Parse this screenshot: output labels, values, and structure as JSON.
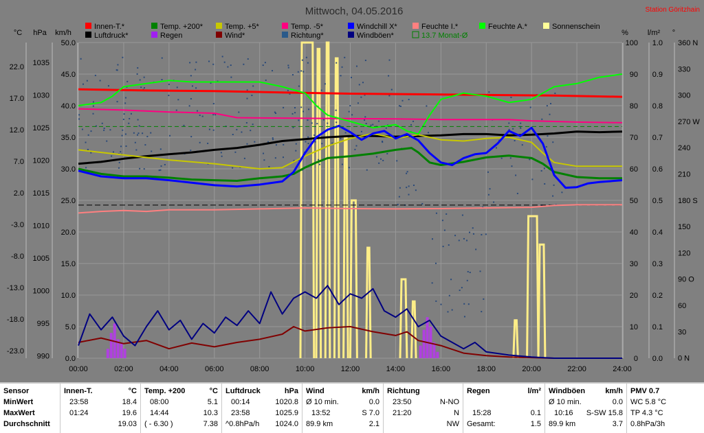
{
  "title": "Mittwoch, 04.05.2016",
  "station": "Station Göritzhain",
  "left_axis_units": [
    "°C",
    "hPa",
    "km/h"
  ],
  "right_axis_units": [
    "%",
    "l/m²",
    "°"
  ],
  "legend": [
    {
      "label": "Innen-T.*",
      "color": "#ff0000"
    },
    {
      "label": "Luftdruck*",
      "color": "#000000"
    },
    {
      "label": "Temp. +200*",
      "color": "#008000"
    },
    {
      "label": "Regen",
      "color": "#a020f0"
    },
    {
      "label": "Temp. +5*",
      "color": "#c8c800"
    },
    {
      "label": "Wind*",
      "color": "#800000"
    },
    {
      "label": "Temp. -5*",
      "color": "#ff0080"
    },
    {
      "label": "Richtung*",
      "color": "#2a5a8a"
    },
    {
      "label": "Windchill X*",
      "color": "#0000ff"
    },
    {
      "label": "Windböen*",
      "color": "#000080"
    },
    {
      "label": "Feuchte I.*",
      "color": "#ff8080"
    },
    {
      "label": "13.7 Monat-Ø",
      "color": "#008000"
    },
    {
      "label": "Feuchte A.*",
      "color": "#00ff00"
    },
    {
      "label": "Sonnenschein",
      "color": "#ffff99"
    }
  ],
  "chart_data": {
    "type": "line",
    "x_ticks": [
      "00:00",
      "02:00",
      "04:00",
      "06:00",
      "08:00",
      "10:00",
      "12:00",
      "14:00",
      "16:00",
      "18:00",
      "20:00",
      "22:00",
      "24:00"
    ],
    "y_axes": {
      "temp_c": [
        "22.0",
        "17.0",
        "12.0",
        "7.0",
        "2.0",
        "-3.0",
        "-8.0",
        "-13.0",
        "-18.0",
        "-23.0"
      ],
      "pressure_hpa": [
        "1035",
        "1030",
        "1025",
        "1020",
        "1015",
        "1010",
        "1005",
        "1000",
        "995",
        "990"
      ],
      "wind_kmh": [
        "50.0",
        "45.0",
        "40.0",
        "35.0",
        "30.0",
        "25.0",
        "20.0",
        "15.0",
        "10.0",
        "5.0",
        "0.0"
      ],
      "humidity_pct": [
        "100",
        "90",
        "80",
        "70",
        "60",
        "50",
        "40",
        "30",
        "20",
        "10",
        "0"
      ],
      "rain_lm2": [
        "1.0",
        "0.9",
        "0.8",
        "0.7",
        "0.6",
        "0.5",
        "0.4",
        "0.3",
        "0.2",
        "0.1",
        "0.0"
      ],
      "direction_deg": [
        "360 N",
        "330",
        "300",
        "270 W",
        "240",
        "210",
        "180 S",
        "150",
        "120",
        "90 O",
        "60",
        "30",
        "0 N"
      ]
    },
    "grid": true,
    "series": [
      {
        "name": "Innen-T.*",
        "axis": "temp_c",
        "points": [
          [
            0,
            19.6
          ],
          [
            3,
            19.4
          ],
          [
            6,
            19.3
          ],
          [
            9,
            19.1
          ],
          [
            12,
            18.9
          ],
          [
            15,
            18.8
          ],
          [
            18,
            18.7
          ],
          [
            21,
            18.6
          ],
          [
            24,
            18.4
          ]
        ]
      },
      {
        "name": "Luftdruck*",
        "axis": "pressure_hpa",
        "points": [
          [
            0,
            1020.8
          ],
          [
            1,
            1021.1
          ],
          [
            2,
            1021.6
          ],
          [
            3,
            1022.0
          ],
          [
            4,
            1022.3
          ],
          [
            5,
            1022.6
          ],
          [
            6,
            1023.0
          ],
          [
            7,
            1023.3
          ],
          [
            8,
            1023.8
          ],
          [
            9,
            1024.4
          ],
          [
            10,
            1024.7
          ],
          [
            11,
            1025.0
          ],
          [
            12,
            1025.2
          ],
          [
            13,
            1025.2
          ],
          [
            14,
            1025.1
          ],
          [
            15,
            1025.2
          ],
          [
            16,
            1025.3
          ],
          [
            17,
            1025.5
          ],
          [
            18,
            1025.5
          ],
          [
            19,
            1025.3
          ],
          [
            20,
            1025.4
          ],
          [
            21,
            1025.6
          ],
          [
            22,
            1025.9
          ],
          [
            23,
            1025.8
          ],
          [
            24,
            1025.9
          ]
        ]
      },
      {
        "name": "Temp. +200*",
        "axis": "temp_c",
        "points": [
          [
            0,
            7.0
          ],
          [
            1,
            6.2
          ],
          [
            2,
            5.8
          ],
          [
            3,
            5.8
          ],
          [
            4,
            5.6
          ],
          [
            5,
            5.3
          ],
          [
            6,
            5.2
          ],
          [
            7,
            5.1
          ],
          [
            8,
            5.5
          ],
          [
            9,
            5.8
          ],
          [
            9.5,
            6.2
          ],
          [
            10,
            7.2
          ],
          [
            10.5,
            8.0
          ],
          [
            11,
            8.7
          ],
          [
            12,
            9.0
          ],
          [
            13,
            9.4
          ],
          [
            14,
            10.0
          ],
          [
            14.7,
            10.3
          ],
          [
            15,
            9.6
          ],
          [
            15.5,
            8.0
          ],
          [
            16,
            7.6
          ],
          [
            17,
            8.1
          ],
          [
            18,
            8.8
          ],
          [
            19,
            9.1
          ],
          [
            20,
            8.7
          ],
          [
            20.5,
            7.8
          ],
          [
            21,
            6.5
          ],
          [
            22,
            5.7
          ],
          [
            23,
            5.5
          ],
          [
            24,
            5.5
          ]
        ]
      },
      {
        "name": "Temp. +5*",
        "axis": "temp_c",
        "points": [
          [
            0,
            10.0
          ],
          [
            2,
            9.2
          ],
          [
            4,
            8.4
          ],
          [
            6,
            7.8
          ],
          [
            8,
            7.0
          ],
          [
            9,
            7.2
          ],
          [
            10,
            9.0
          ],
          [
            11,
            10.6
          ],
          [
            12,
            11.8
          ],
          [
            13,
            12.6
          ],
          [
            14,
            11.8
          ],
          [
            15,
            12.4
          ],
          [
            16,
            11.6
          ],
          [
            17,
            11.4
          ],
          [
            18,
            11.8
          ],
          [
            19,
            12.0
          ],
          [
            20,
            11.2
          ],
          [
            20.5,
            9.5
          ],
          [
            21,
            8.0
          ],
          [
            22,
            7.4
          ],
          [
            24,
            7.4
          ]
        ]
      },
      {
        "name": "Temp. -5*",
        "axis": "temp_c",
        "points": [
          [
            0,
            16.5
          ],
          [
            2,
            16.3
          ],
          [
            4,
            16.0
          ],
          [
            6,
            15.8
          ],
          [
            7,
            15.1
          ],
          [
            10,
            15.0
          ],
          [
            14,
            14.9
          ],
          [
            16,
            14.8
          ],
          [
            19,
            14.8
          ],
          [
            20,
            14.6
          ],
          [
            22,
            14.4
          ],
          [
            24,
            14.3
          ]
        ]
      },
      {
        "name": "Windchill X*",
        "axis": "temp_c",
        "points": [
          [
            0,
            6.7
          ],
          [
            1,
            5.8
          ],
          [
            2,
            5.5
          ],
          [
            3,
            5.5
          ],
          [
            4,
            5.2
          ],
          [
            5,
            4.8
          ],
          [
            6,
            4.4
          ],
          [
            7,
            4.2
          ],
          [
            8,
            4.5
          ],
          [
            9,
            5.0
          ],
          [
            9.5,
            6.5
          ],
          [
            10,
            9.5
          ],
          [
            10.5,
            12.0
          ],
          [
            11,
            13.2
          ],
          [
            11.5,
            13.8
          ],
          [
            12,
            12.8
          ],
          [
            12.5,
            11.6
          ],
          [
            13,
            12.6
          ],
          [
            13.5,
            13.0
          ],
          [
            14,
            11.8
          ],
          [
            14.5,
            12.5
          ],
          [
            15,
            11.5
          ],
          [
            15.5,
            9.5
          ],
          [
            16,
            8.0
          ],
          [
            16.5,
            7.6
          ],
          [
            17,
            8.7
          ],
          [
            17.5,
            9.3
          ],
          [
            18,
            9.5
          ],
          [
            18.5,
            11.0
          ],
          [
            19,
            13.0
          ],
          [
            19.5,
            12.2
          ],
          [
            20,
            13.5
          ],
          [
            20.5,
            11.0
          ],
          [
            21,
            6.0
          ],
          [
            21.5,
            4.0
          ],
          [
            22,
            4.1
          ],
          [
            22.5,
            4.7
          ],
          [
            23,
            4.9
          ],
          [
            24,
            5.2
          ]
        ]
      },
      {
        "name": "Feuchte I.*",
        "axis": "humidity_pct",
        "points": [
          [
            0,
            46
          ],
          [
            1,
            46.5
          ],
          [
            2,
            46.8
          ],
          [
            3,
            46.5
          ],
          [
            4,
            47
          ],
          [
            5,
            47
          ],
          [
            6,
            47
          ],
          [
            8,
            47.3
          ],
          [
            10,
            47.6
          ],
          [
            12,
            47.4
          ],
          [
            14,
            47.3
          ],
          [
            16,
            47.4
          ],
          [
            18,
            47.6
          ],
          [
            20,
            47.8
          ],
          [
            21,
            48.4
          ],
          [
            22,
            48.6
          ],
          [
            24,
            48.6
          ]
        ]
      },
      {
        "name": "Feuchte A.*",
        "axis": "humidity_pct",
        "points": [
          [
            0,
            80
          ],
          [
            1,
            81
          ],
          [
            1.5,
            83
          ],
          [
            2,
            86
          ],
          [
            3,
            87
          ],
          [
            4,
            88
          ],
          [
            5,
            87.5
          ],
          [
            6,
            87.5
          ],
          [
            7,
            87.5
          ],
          [
            8,
            87.5
          ],
          [
            9,
            86
          ],
          [
            10,
            84
          ],
          [
            10.5,
            80
          ],
          [
            11,
            77
          ],
          [
            12,
            75
          ],
          [
            13,
            73
          ],
          [
            14,
            74
          ],
          [
            14.5,
            72
          ],
          [
            15,
            71
          ],
          [
            15.5,
            77
          ],
          [
            16,
            82
          ],
          [
            17,
            84
          ],
          [
            18,
            83
          ],
          [
            19,
            81
          ],
          [
            20,
            82
          ],
          [
            21,
            86
          ],
          [
            22,
            87
          ],
          [
            23,
            89
          ],
          [
            24,
            90
          ]
        ]
      },
      {
        "name": "13.7 Monat-Ø",
        "axis": "temp_c",
        "points": [
          [
            0,
            13.7
          ],
          [
            24,
            13.7
          ]
        ]
      },
      {
        "name": "Wind*",
        "axis": "wind_kmh",
        "points": [
          [
            0,
            2.5
          ],
          [
            1,
            3.2
          ],
          [
            2,
            2.3
          ],
          [
            3,
            2.8
          ],
          [
            4,
            1.5
          ],
          [
            5,
            2.4
          ],
          [
            6,
            1.8
          ],
          [
            7,
            2.5
          ],
          [
            8,
            3.0
          ],
          [
            9,
            3.8
          ],
          [
            9.5,
            5.0
          ],
          [
            10,
            4.3
          ],
          [
            11,
            4.8
          ],
          [
            12,
            5.0
          ],
          [
            13,
            4.2
          ],
          [
            14,
            3.6
          ],
          [
            14.5,
            4.2
          ],
          [
            15,
            2.8
          ],
          [
            16,
            2.0
          ],
          [
            17,
            0.8
          ],
          [
            18,
            0.4
          ],
          [
            19,
            0.2
          ],
          [
            20,
            0.1
          ],
          [
            21,
            0.0
          ],
          [
            24,
            0.0
          ]
        ]
      },
      {
        "name": "Windböen*",
        "axis": "wind_kmh",
        "points": [
          [
            0,
            2.0
          ],
          [
            0.5,
            7.0
          ],
          [
            1,
            4.5
          ],
          [
            1.5,
            6.5
          ],
          [
            2,
            3.5
          ],
          [
            2.5,
            2.0
          ],
          [
            3,
            5.0
          ],
          [
            3.5,
            7.5
          ],
          [
            4,
            4.5
          ],
          [
            4.5,
            6.0
          ],
          [
            5,
            3.0
          ],
          [
            5.5,
            5.5
          ],
          [
            6,
            4.0
          ],
          [
            6.5,
            6.5
          ],
          [
            7,
            5.2
          ],
          [
            7.5,
            7.5
          ],
          [
            8,
            5.5
          ],
          [
            8.5,
            10.5
          ],
          [
            9,
            7.0
          ],
          [
            9.5,
            9.5
          ],
          [
            10,
            10.5
          ],
          [
            10.5,
            9.5
          ],
          [
            11,
            11.5
          ],
          [
            11.5,
            8.5
          ],
          [
            12,
            10.2
          ],
          [
            12.5,
            9.5
          ],
          [
            13,
            11.0
          ],
          [
            13.5,
            7.5
          ],
          [
            14,
            6.5
          ],
          [
            14.5,
            7.8
          ],
          [
            15,
            5.0
          ],
          [
            15.5,
            6.0
          ],
          [
            16,
            3.5
          ],
          [
            16.5,
            2.5
          ],
          [
            17,
            1.5
          ],
          [
            17.5,
            2.5
          ],
          [
            18,
            1.0
          ],
          [
            19,
            0.5
          ],
          [
            20,
            0.2
          ],
          [
            21,
            0.0
          ],
          [
            22,
            0.0
          ],
          [
            24,
            0.0
          ]
        ]
      }
    ]
  },
  "stats": {
    "labels": {
      "header": "Sensor",
      "min": "MinWert",
      "max": "MaxWert",
      "avg": "Durchschnitt"
    },
    "innen": {
      "name": "Innen-T.",
      "unit": "°C",
      "min_time": "23:58",
      "min": "18.4",
      "max_time": "01:24",
      "max": "19.6",
      "avg": "19.03"
    },
    "temp200": {
      "name": "Temp. +200",
      "unit": "°C",
      "min_time": "08:00",
      "min": "5.1",
      "max_time": "14:44",
      "max": "10.3",
      "avg_note": "( - 6.30 )",
      "avg": "7.38"
    },
    "druck": {
      "name": "Luftdruck",
      "unit": "hPa",
      "min_time": "00:14",
      "min": "1020.8",
      "max_time": "23:58",
      "max": "1025.9",
      "avg_note": "^0.8hPa/h",
      "avg": "1024.0"
    },
    "wind": {
      "name": "Wind",
      "unit": "km/h",
      "r1_label": "Ø 10 min.",
      "r1_val": "0.0",
      "r2_label": "13:52",
      "r2_val": "S 7.0",
      "r3_label": "89.9 km",
      "r3_val": "2.1"
    },
    "richtung": {
      "name": "Richtung",
      "r1_time": "23:50",
      "r1_val": "N-NO",
      "r2_time": "21:20",
      "r2_val": "N",
      "r3_val": "NW"
    },
    "regen": {
      "name": "Regen",
      "unit": "l/m²",
      "r2_time": "15:28",
      "r2_val": "0.1",
      "r3_label": "Gesamt:",
      "r3_val": "1.5"
    },
    "boeen": {
      "name": "Windböen",
      "unit": "km/h",
      "r1_label": "Ø 10 min.",
      "r1_val": "0.0",
      "r2_time": "10:16",
      "r2_val": "S-SW 15.8",
      "r3_label": "89.9 km",
      "r3_val": "3.7"
    },
    "pmv": {
      "name": "PMV 0.7",
      "r1": "WC 5.8 °C",
      "r2": "TP 4.3 °C",
      "r3": "0.8hPa/3h"
    }
  }
}
